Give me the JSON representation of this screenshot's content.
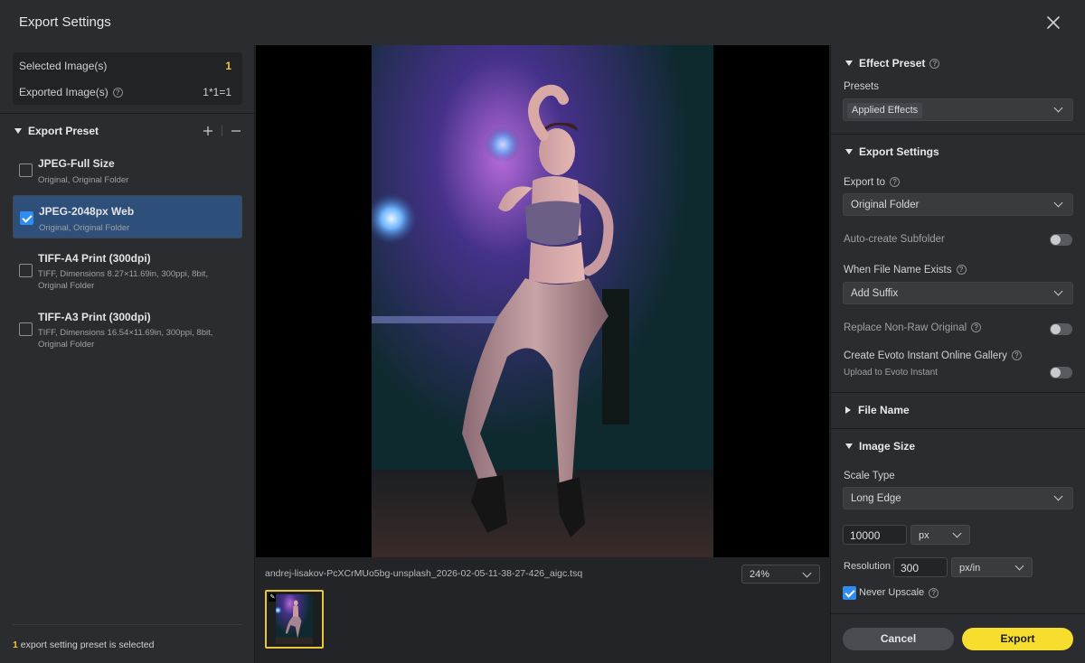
{
  "window": {
    "title": "Export Settings"
  },
  "left": {
    "selected_label": "Selected Image(s)",
    "selected_value": "1",
    "exported_label": "Exported Image(s)",
    "exported_value": "1*1=1",
    "section_title": "Export Preset",
    "presets": [
      {
        "name": "JPEG-Full Size",
        "desc": "Original, Original Folder",
        "checked": false
      },
      {
        "name": "JPEG-2048px Web",
        "desc": "Original, Original Folder",
        "checked": true
      },
      {
        "name": "TIFF-A4 Print (300dpi)",
        "desc": "TIFF, Dimensions 8.27×11.69in, 300ppi, 8bit, Original Folder",
        "checked": false
      },
      {
        "name": "TIFF-A3 Print (300dpi)",
        "desc": "TIFF, Dimensions 16.54×11.69in, 300ppi, 8bit, Original Folder",
        "checked": false
      }
    ],
    "footer_count": "1",
    "footer_text": " export setting preset is selected"
  },
  "center": {
    "filename": "andrej-lisakov-PcXCrMUo5bg-unsplash_2026-02-05-11-38-27-426_aigc.tsq",
    "zoom": "24%"
  },
  "right": {
    "effect_preset": {
      "title": "Effect Preset",
      "presets_label": "Presets",
      "presets_value": "Applied Effects"
    },
    "export_settings": {
      "title": "Export Settings",
      "export_to_label": "Export to",
      "export_to_value": "Original Folder",
      "auto_subfolder_label": "Auto-create Subfolder",
      "file_exists_label": "When File Name Exists",
      "file_exists_value": "Add Suffix",
      "replace_label": "Replace Non-Raw Original",
      "gallery_label": "Create Evoto Instant Online Gallery",
      "gallery_sub": "Upload to Evoto Instant"
    },
    "file_name": {
      "title": "File Name"
    },
    "image_size": {
      "title": "Image Size",
      "scale_type_label": "Scale Type",
      "scale_type_value": "Long Edge",
      "size_value": "10000",
      "size_unit": "px",
      "resolution_label": "Resolution",
      "resolution_value": "300",
      "resolution_unit": "px/in",
      "never_upscale_label": "Never Upscale"
    },
    "cancel_label": "Cancel",
    "export_label": "Export"
  },
  "colors": {
    "accent_yellow": "#f7dd2e",
    "selection_blue": "#2e4f7a",
    "checkbox_blue": "#2f8cf0"
  }
}
